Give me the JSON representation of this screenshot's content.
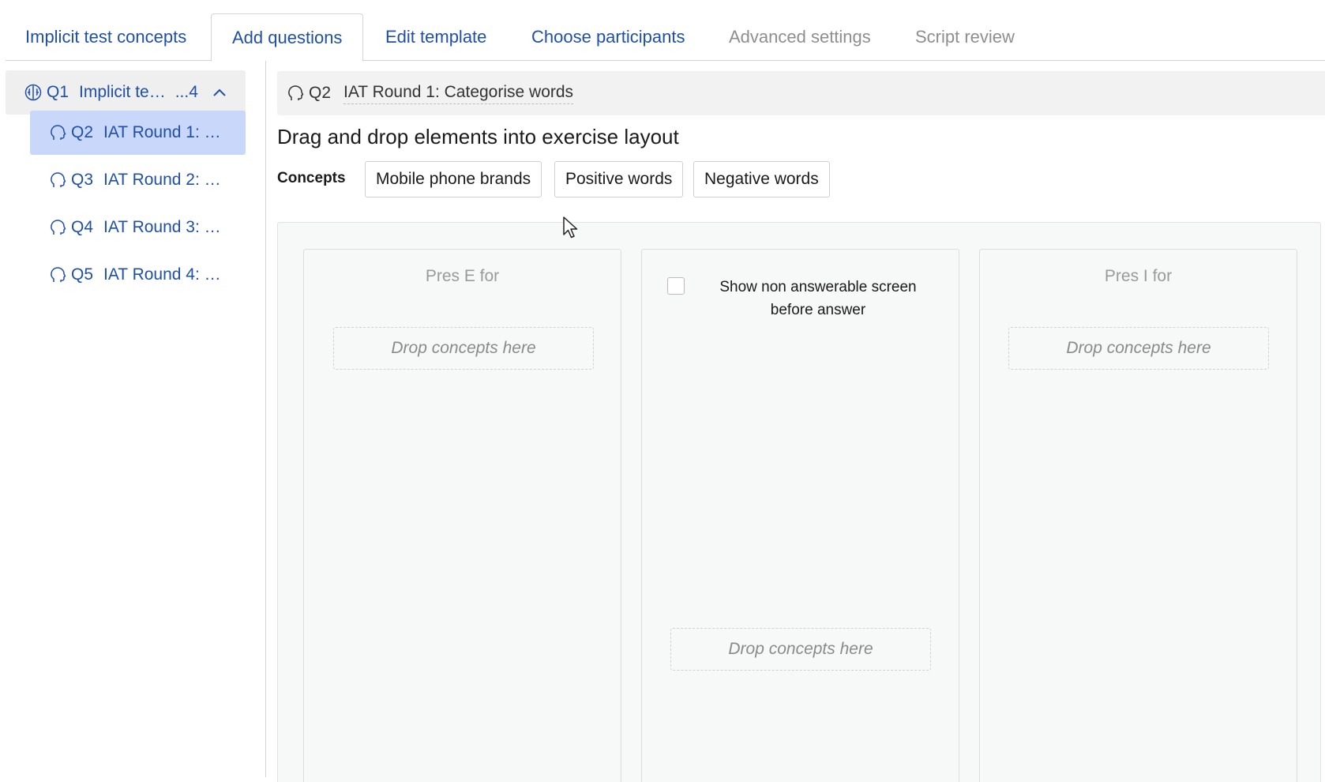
{
  "tabs": [
    {
      "label": "Implicit test concepts",
      "state": "normal"
    },
    {
      "label": "Add questions",
      "state": "active"
    },
    {
      "label": "Edit template",
      "state": "normal"
    },
    {
      "label": "Choose participants",
      "state": "normal"
    },
    {
      "label": "Advanced settings",
      "state": "disabled"
    },
    {
      "label": "Script review",
      "state": "disabled"
    }
  ],
  "sidebar": {
    "group": {
      "icon": "brain-icon",
      "number": "Q1",
      "title": "Implicit te…",
      "suffix": "...4",
      "toggle_icon": "chevron-up-icon"
    },
    "items": [
      {
        "icon": "head-icon",
        "number": "Q2",
        "title": "IAT Round 1: …",
        "selected": true
      },
      {
        "icon": "head-icon",
        "number": "Q3",
        "title": "IAT Round 2: …",
        "selected": false
      },
      {
        "icon": "head-icon",
        "number": "Q4",
        "title": "IAT Round 3: …",
        "selected": false
      },
      {
        "icon": "head-icon",
        "number": "Q5",
        "title": "IAT Round 4: …",
        "selected": false
      }
    ]
  },
  "question": {
    "icon": "head-icon",
    "number": "Q2",
    "title": "IAT Round 1: Categorise words"
  },
  "heading": "Drag and drop elements into exercise layout",
  "concepts": {
    "label": "Concepts",
    "items": [
      "Mobile phone brands",
      "Positive words",
      "Negative words"
    ]
  },
  "layout": {
    "left_column": {
      "title": "Pres E for",
      "dropzone": "Drop concepts here"
    },
    "middle_column": {
      "checkbox_label": "Show non answerable screen before answer",
      "checked": false,
      "dropzone": "Drop concepts here"
    },
    "right_column": {
      "title": "Pres I for",
      "dropzone": "Drop concepts here"
    }
  },
  "colors": {
    "link": "#1f4fa8",
    "disabled": "#8e8e8e",
    "selected_bg": "#c9d7fb",
    "panel_bg": "#f7f8f8"
  }
}
